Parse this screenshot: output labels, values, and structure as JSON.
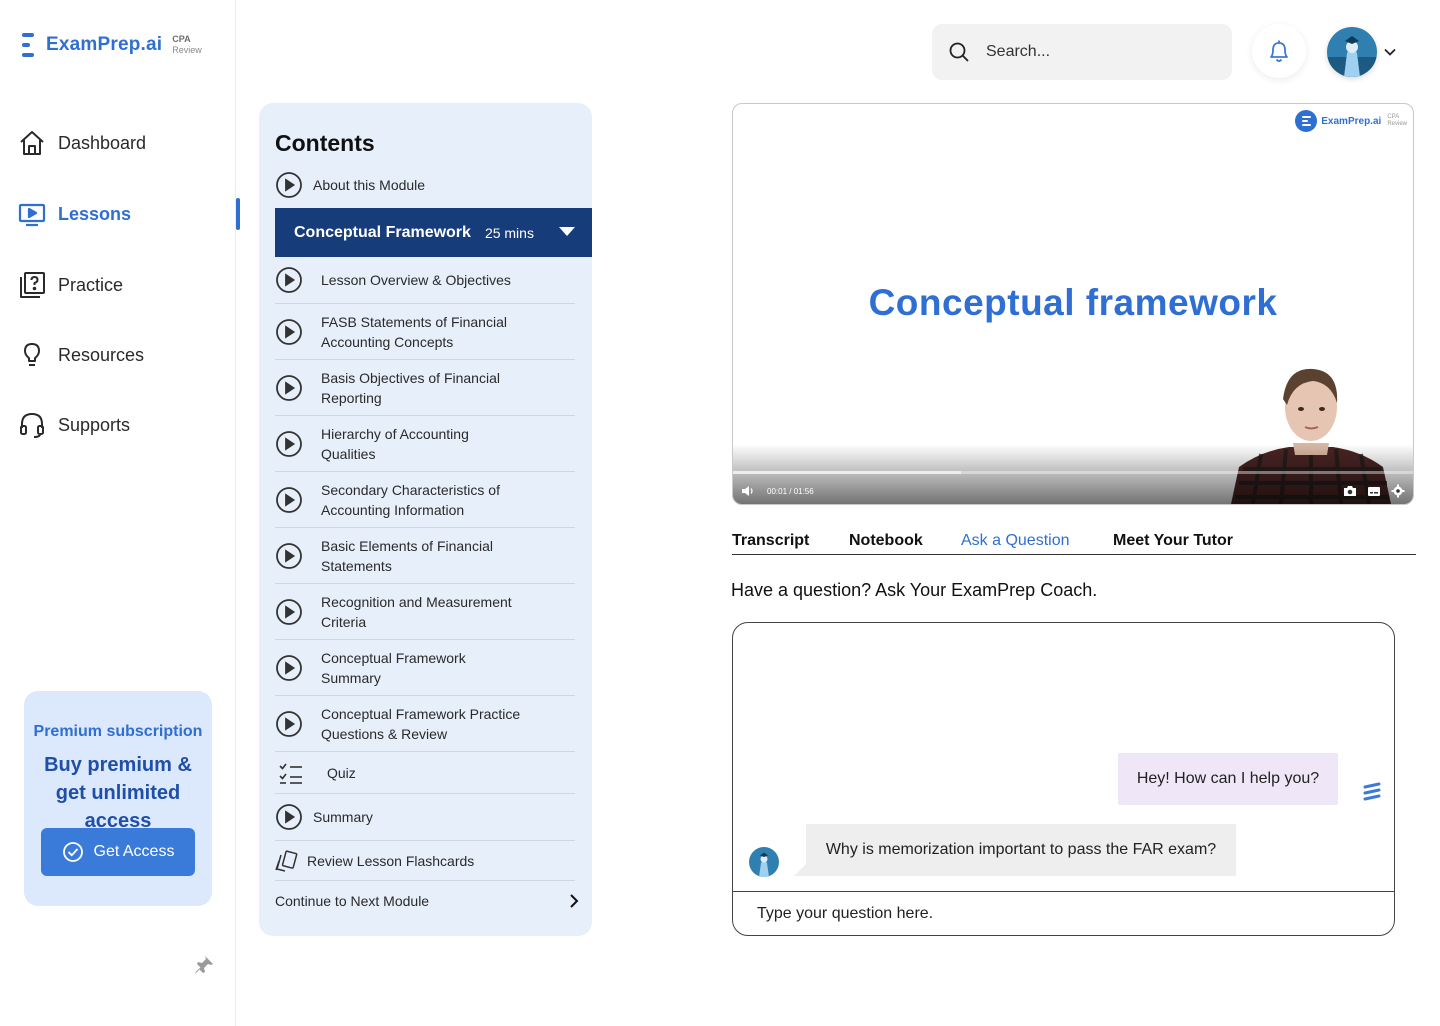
{
  "brand": {
    "name": "ExamPrep.ai",
    "tag_line1": "CPA",
    "tag_line2": "Review",
    "accent": "#2f6fd3"
  },
  "nav": {
    "items": [
      {
        "label": "Dashboard",
        "icon": "home-icon",
        "active": false
      },
      {
        "label": "Lessons",
        "icon": "monitor-play-icon",
        "active": true
      },
      {
        "label": "Practice",
        "icon": "question-card-icon",
        "active": false
      },
      {
        "label": "Resources",
        "icon": "lightbulb-icon",
        "active": false
      },
      {
        "label": "Supports",
        "icon": "headset-icon",
        "active": false
      }
    ]
  },
  "promo": {
    "kicker": "Premium subscription",
    "title": "Buy premium & get unlimited access",
    "button": "Get Access"
  },
  "header": {
    "search_placeholder": "Search..."
  },
  "contents": {
    "title": "Contents",
    "about": "About this Module",
    "section": {
      "title": "Conceptual Framework",
      "duration": "25 mins",
      "expanded": true
    },
    "lessons": [
      {
        "label": "Lesson Overview & Objectives",
        "icon": "play-circle-icon"
      },
      {
        "label": "FASB Statements of Financial Accounting Concepts",
        "icon": "play-circle-icon"
      },
      {
        "label": "Basis Objectives of Financial Reporting",
        "icon": "play-circle-icon"
      },
      {
        "label": "Hierarchy of Accounting Qualities",
        "icon": "play-circle-icon"
      },
      {
        "label": "Secondary Characteristics of Accounting Information",
        "icon": "play-circle-icon"
      },
      {
        "label": "Basic Elements of Financial Statements",
        "icon": "play-circle-icon"
      },
      {
        "label": "Recognition and Measurement Criteria",
        "icon": "play-circle-icon"
      },
      {
        "label": "Conceptual Framework Summary",
        "icon": "play-circle-icon"
      },
      {
        "label": "Conceptual Framework Practice Questions & Review",
        "icon": "play-circle-icon"
      },
      {
        "label": "Quiz",
        "icon": "checklist-icon"
      },
      {
        "label": "Summary",
        "icon": "play-circle-icon"
      },
      {
        "label": "Review Lesson Flashcards",
        "icon": "flashcards-icon"
      }
    ],
    "continue": "Continue to Next Module"
  },
  "video": {
    "title": "Conceptual framework",
    "logo": "ExamPrep.ai",
    "logo_tag1": "CPA",
    "logo_tag2": "Review",
    "time": "00:01 / 01:56",
    "progress": 0.335
  },
  "tabs": [
    {
      "label": "Transcript",
      "active": false
    },
    {
      "label": "Notebook",
      "active": false
    },
    {
      "label": "Ask a Question",
      "active": true
    },
    {
      "label": "Meet Your Tutor",
      "active": false
    }
  ],
  "ask": {
    "prompt": "Have a question? Ask Your ExamPrep Coach.",
    "coach_message": "Hey! How can I help you?",
    "user_message": "Why is memorization important to pass the FAR exam?",
    "input_placeholder": "Type your question here."
  }
}
